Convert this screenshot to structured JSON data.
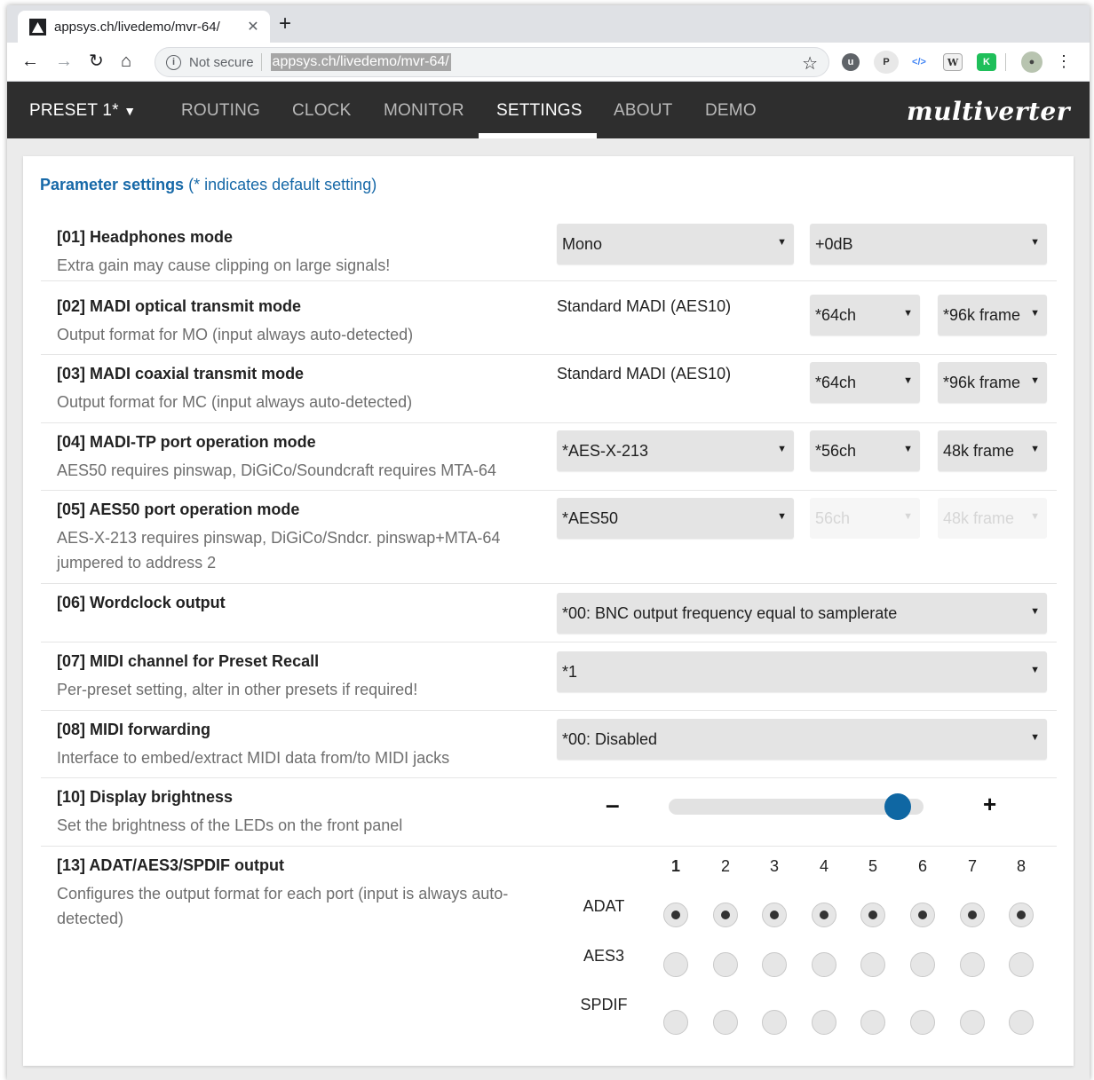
{
  "browser": {
    "tab_title": "appsys.ch/livedemo/mvr-64/",
    "tab_close": "✕",
    "new_tab": "+",
    "not_secure": "Not secure",
    "url": "appsys.ch/livedemo/mvr-64/",
    "icons": [
      "back-arrow-icon",
      "forward-arrow-icon",
      "reload-icon",
      "home-icon",
      "info-icon",
      "star-icon",
      "menu-icon"
    ]
  },
  "nav": {
    "preset": "PRESET 1*",
    "items": [
      "ROUTING",
      "CLOCK",
      "MONITOR",
      "SETTINGS",
      "ABOUT",
      "DEMO"
    ],
    "active": "SETTINGS",
    "brand": "multiverter"
  },
  "page": {
    "heading_bold": "Parameter settings",
    "heading_rest": " (* indicates default setting)"
  },
  "params": [
    {
      "title": "[01] Headphones mode",
      "desc": "Extra gain may cause clipping on large signals!",
      "sel1": "Mono",
      "sel2": "+0dB"
    },
    {
      "title": "[02] MADI optical transmit mode",
      "desc": "Output format for MO (input always auto-detected)",
      "static": "Standard MADI (AES10)",
      "sel1": "*64ch",
      "sel2": "*96k frame"
    },
    {
      "title": "[03] MADI coaxial transmit mode",
      "desc": "Output format for MC (input always auto-detected)",
      "static": "Standard MADI (AES10)",
      "sel1": "*64ch",
      "sel2": "*96k frame"
    },
    {
      "title": "[04] MADI-TP port operation mode",
      "desc": "AES50 requires pinswap, DiGiCo/Soundcraft requires MTA-64",
      "sel1": "*AES-X-213",
      "sel2": "*56ch",
      "sel3": "48k frame"
    },
    {
      "title": "[05] AES50 port operation mode",
      "desc": "AES-X-213 requires pinswap, DiGiCo/Sndcr. pinswap+MTA-64 jumpered to address 2",
      "sel1": "*AES50",
      "sel2": "56ch",
      "sel3": "48k frame"
    },
    {
      "title": "[06] Wordclock output",
      "sel1": "*00: BNC output frequency equal to samplerate"
    },
    {
      "title": "[07] MIDI channel for Preset Recall",
      "desc": "Per-preset setting, alter in other presets if required!",
      "sel1": "*1"
    },
    {
      "title": "[08] MIDI forwarding",
      "desc": "Interface to embed/extract MIDI data from/to MIDI jacks",
      "sel1": "*00: Disabled"
    },
    {
      "title": "[10] Display brightness",
      "desc": "Set the brightness of the LEDs on the front panel",
      "minus": "–",
      "plus": "+"
    },
    {
      "title": "[13] ADAT/AES3/SPDIF output",
      "desc": "Configures the output format for each port (input is always auto-detected)"
    }
  ],
  "brightness": {
    "value": 0.95
  },
  "ports": {
    "numbers": [
      "1",
      "2",
      "3",
      "4",
      "5",
      "6",
      "7",
      "8"
    ],
    "labels": [
      "ADAT",
      "AES3",
      "SPDIF"
    ],
    "selected": [
      "ADAT",
      "ADAT",
      "ADAT",
      "ADAT",
      "ADAT",
      "ADAT",
      "ADAT",
      "ADAT"
    ]
  },
  "colors": {
    "accent": "#1769a8",
    "nav_bg": "#2e2e2e",
    "slider_thumb": "#0f67a3"
  }
}
